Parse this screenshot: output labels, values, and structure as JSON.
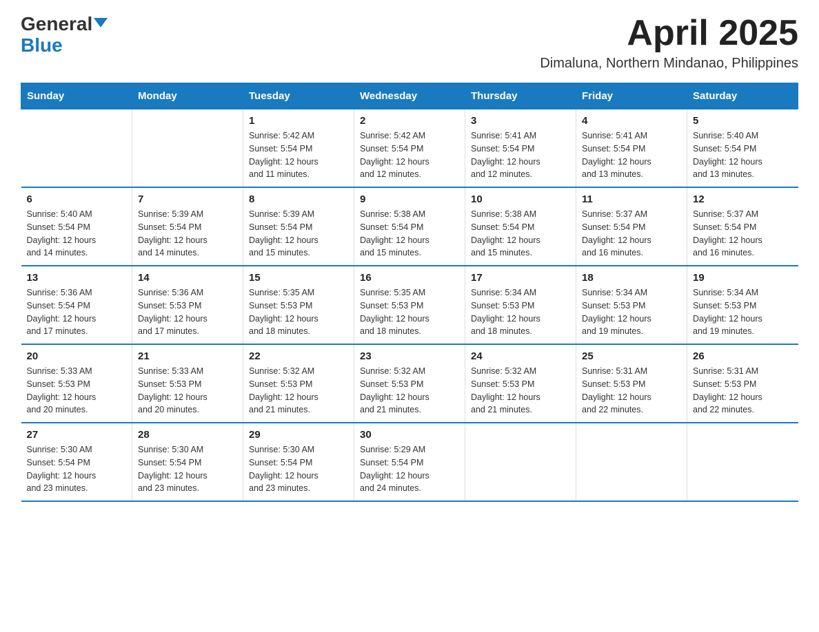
{
  "header": {
    "logo_general": "General",
    "logo_blue": "Blue",
    "month_title": "April 2025",
    "location": "Dimaluna, Northern Mindanao, Philippines"
  },
  "days_of_week": [
    "Sunday",
    "Monday",
    "Tuesday",
    "Wednesday",
    "Thursday",
    "Friday",
    "Saturday"
  ],
  "weeks": [
    [
      {
        "day": "",
        "info": ""
      },
      {
        "day": "",
        "info": ""
      },
      {
        "day": "1",
        "info": "Sunrise: 5:42 AM\nSunset: 5:54 PM\nDaylight: 12 hours\nand 11 minutes."
      },
      {
        "day": "2",
        "info": "Sunrise: 5:42 AM\nSunset: 5:54 PM\nDaylight: 12 hours\nand 12 minutes."
      },
      {
        "day": "3",
        "info": "Sunrise: 5:41 AM\nSunset: 5:54 PM\nDaylight: 12 hours\nand 12 minutes."
      },
      {
        "day": "4",
        "info": "Sunrise: 5:41 AM\nSunset: 5:54 PM\nDaylight: 12 hours\nand 13 minutes."
      },
      {
        "day": "5",
        "info": "Sunrise: 5:40 AM\nSunset: 5:54 PM\nDaylight: 12 hours\nand 13 minutes."
      }
    ],
    [
      {
        "day": "6",
        "info": "Sunrise: 5:40 AM\nSunset: 5:54 PM\nDaylight: 12 hours\nand 14 minutes."
      },
      {
        "day": "7",
        "info": "Sunrise: 5:39 AM\nSunset: 5:54 PM\nDaylight: 12 hours\nand 14 minutes."
      },
      {
        "day": "8",
        "info": "Sunrise: 5:39 AM\nSunset: 5:54 PM\nDaylight: 12 hours\nand 15 minutes."
      },
      {
        "day": "9",
        "info": "Sunrise: 5:38 AM\nSunset: 5:54 PM\nDaylight: 12 hours\nand 15 minutes."
      },
      {
        "day": "10",
        "info": "Sunrise: 5:38 AM\nSunset: 5:54 PM\nDaylight: 12 hours\nand 15 minutes."
      },
      {
        "day": "11",
        "info": "Sunrise: 5:37 AM\nSunset: 5:54 PM\nDaylight: 12 hours\nand 16 minutes."
      },
      {
        "day": "12",
        "info": "Sunrise: 5:37 AM\nSunset: 5:54 PM\nDaylight: 12 hours\nand 16 minutes."
      }
    ],
    [
      {
        "day": "13",
        "info": "Sunrise: 5:36 AM\nSunset: 5:54 PM\nDaylight: 12 hours\nand 17 minutes."
      },
      {
        "day": "14",
        "info": "Sunrise: 5:36 AM\nSunset: 5:53 PM\nDaylight: 12 hours\nand 17 minutes."
      },
      {
        "day": "15",
        "info": "Sunrise: 5:35 AM\nSunset: 5:53 PM\nDaylight: 12 hours\nand 18 minutes."
      },
      {
        "day": "16",
        "info": "Sunrise: 5:35 AM\nSunset: 5:53 PM\nDaylight: 12 hours\nand 18 minutes."
      },
      {
        "day": "17",
        "info": "Sunrise: 5:34 AM\nSunset: 5:53 PM\nDaylight: 12 hours\nand 18 minutes."
      },
      {
        "day": "18",
        "info": "Sunrise: 5:34 AM\nSunset: 5:53 PM\nDaylight: 12 hours\nand 19 minutes."
      },
      {
        "day": "19",
        "info": "Sunrise: 5:34 AM\nSunset: 5:53 PM\nDaylight: 12 hours\nand 19 minutes."
      }
    ],
    [
      {
        "day": "20",
        "info": "Sunrise: 5:33 AM\nSunset: 5:53 PM\nDaylight: 12 hours\nand 20 minutes."
      },
      {
        "day": "21",
        "info": "Sunrise: 5:33 AM\nSunset: 5:53 PM\nDaylight: 12 hours\nand 20 minutes."
      },
      {
        "day": "22",
        "info": "Sunrise: 5:32 AM\nSunset: 5:53 PM\nDaylight: 12 hours\nand 21 minutes."
      },
      {
        "day": "23",
        "info": "Sunrise: 5:32 AM\nSunset: 5:53 PM\nDaylight: 12 hours\nand 21 minutes."
      },
      {
        "day": "24",
        "info": "Sunrise: 5:32 AM\nSunset: 5:53 PM\nDaylight: 12 hours\nand 21 minutes."
      },
      {
        "day": "25",
        "info": "Sunrise: 5:31 AM\nSunset: 5:53 PM\nDaylight: 12 hours\nand 22 minutes."
      },
      {
        "day": "26",
        "info": "Sunrise: 5:31 AM\nSunset: 5:53 PM\nDaylight: 12 hours\nand 22 minutes."
      }
    ],
    [
      {
        "day": "27",
        "info": "Sunrise: 5:30 AM\nSunset: 5:54 PM\nDaylight: 12 hours\nand 23 minutes."
      },
      {
        "day": "28",
        "info": "Sunrise: 5:30 AM\nSunset: 5:54 PM\nDaylight: 12 hours\nand 23 minutes."
      },
      {
        "day": "29",
        "info": "Sunrise: 5:30 AM\nSunset: 5:54 PM\nDaylight: 12 hours\nand 23 minutes."
      },
      {
        "day": "30",
        "info": "Sunrise: 5:29 AM\nSunset: 5:54 PM\nDaylight: 12 hours\nand 24 minutes."
      },
      {
        "day": "",
        "info": ""
      },
      {
        "day": "",
        "info": ""
      },
      {
        "day": "",
        "info": ""
      }
    ]
  ]
}
